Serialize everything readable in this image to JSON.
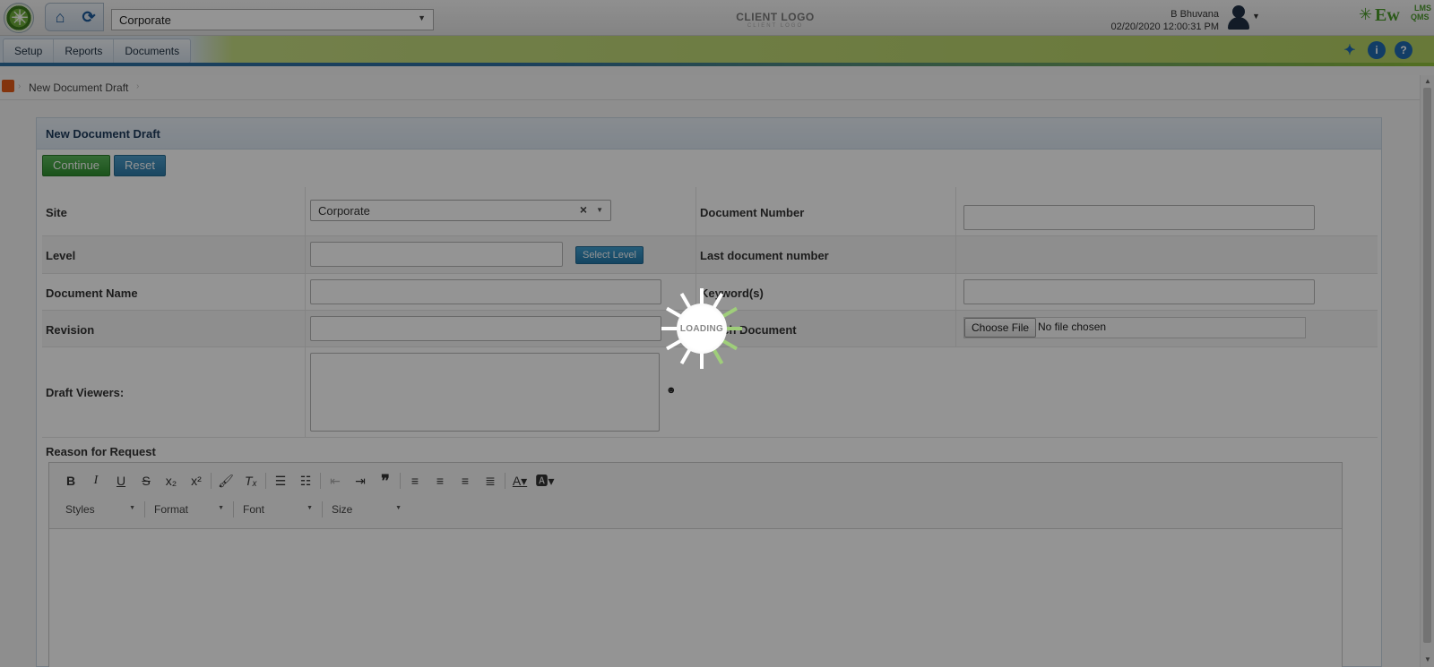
{
  "header": {
    "site_value": "Corporate",
    "client_logo": "CLIENT LOGO",
    "client_logo_sub": "CLIENT LOGO",
    "user_name": "B Bhuvana",
    "datetime": "02/20/2020 12:00:31 PM",
    "brand_main": "Ew",
    "brand_lms": "LMS",
    "brand_qms": "QMS"
  },
  "menu": {
    "items": [
      "Setup",
      "Reports",
      "Documents"
    ]
  },
  "breadcrumb": {
    "current": "New Document Draft"
  },
  "panel": {
    "title": "New Document Draft",
    "continue_label": "Continue",
    "reset_label": "Reset"
  },
  "form": {
    "site_label": "Site",
    "site_value": "Corporate",
    "document_number_label": "Document Number",
    "level_label": "Level",
    "select_level_label": "Select Level",
    "last_document_number_label": "Last document number",
    "document_name_label": "Document Name",
    "keywords_label": "Keyword(s)",
    "revision_label": "Revision",
    "attach_document_label": "Attach Document",
    "choose_file_label": "Choose File",
    "no_file_text": "No file chosen",
    "draft_viewers_label": "Draft Viewers:",
    "reason_label": "Reason for Request"
  },
  "editor": {
    "styles": "Styles",
    "format": "Format",
    "font": "Font",
    "size": "Size"
  },
  "loading": {
    "text": "LOADING"
  },
  "colors": {
    "accent_blue": "#1f6ab0",
    "continue_green": "#2f8f2f",
    "menubar_green": "#b4d063"
  }
}
